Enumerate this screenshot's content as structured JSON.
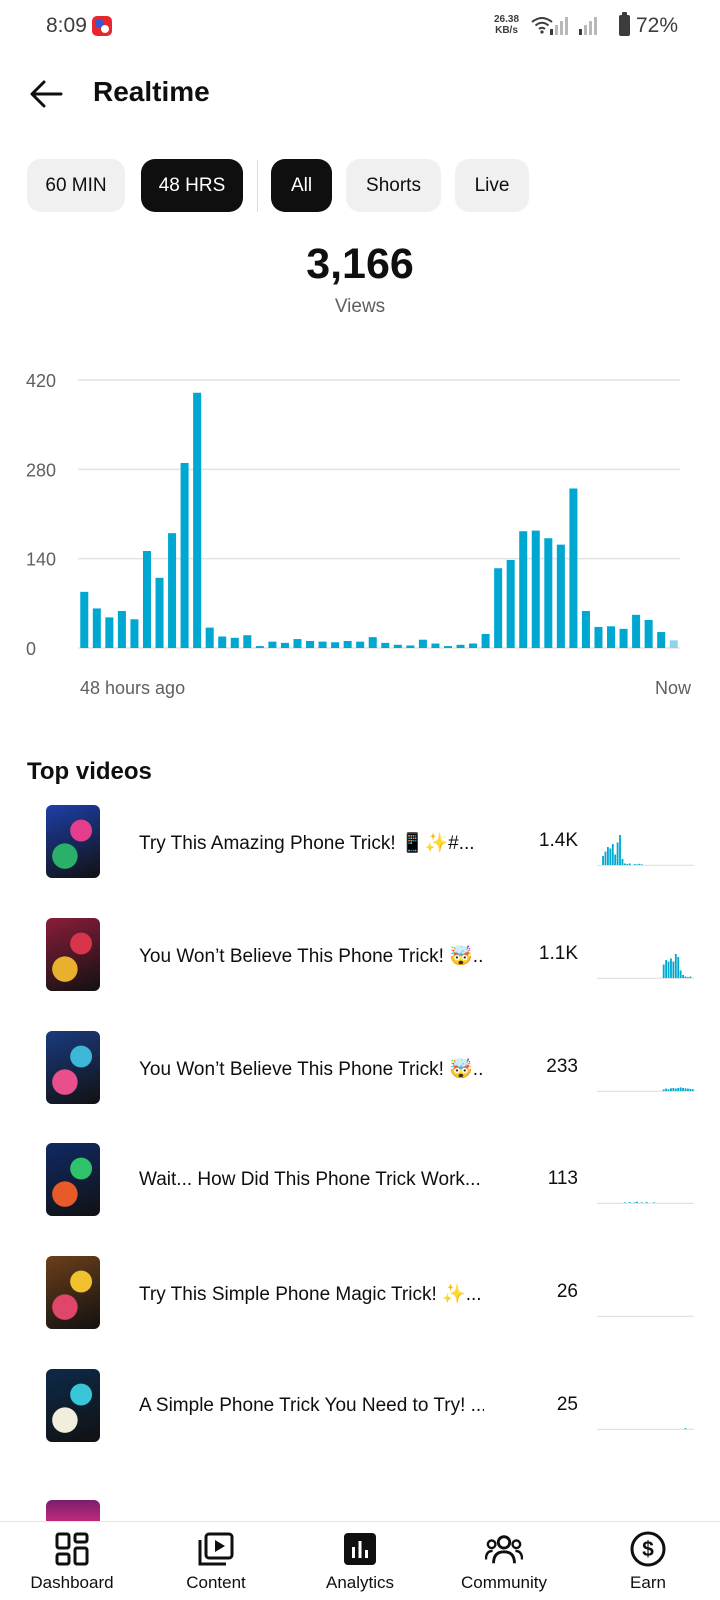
{
  "status_bar": {
    "time": "8:09",
    "net_speed_value": "26.38",
    "net_speed_unit": "KB/s",
    "battery": "72%"
  },
  "header": {
    "title": "Realtime"
  },
  "filters": {
    "time_ranges": [
      {
        "label": "60 MIN",
        "selected": false
      },
      {
        "label": "48 HRS",
        "selected": true
      }
    ],
    "content_types": [
      {
        "label": "All",
        "selected": true
      },
      {
        "label": "Shorts",
        "selected": false
      },
      {
        "label": "Live",
        "selected": false
      }
    ]
  },
  "metric": {
    "value": "3,166",
    "label": "Views"
  },
  "chart_data": {
    "type": "bar",
    "ylim": [
      0,
      420
    ],
    "yticks": [
      "420",
      "280",
      "140",
      "0"
    ],
    "x_start_label": "48 hours ago",
    "x_end_label": "Now",
    "grid": true,
    "bar_color": "#00a8d1",
    "last_bar_color": "#8fd3ea",
    "values": [
      88,
      62,
      48,
      58,
      45,
      152,
      110,
      180,
      290,
      400,
      32,
      18,
      16,
      20,
      3,
      10,
      8,
      14,
      11,
      10,
      9,
      11,
      10,
      17,
      8,
      5,
      4,
      13,
      7,
      3,
      5,
      7,
      22,
      125,
      138,
      183,
      184,
      172,
      162,
      250,
      58,
      33,
      34,
      30,
      52,
      44,
      25,
      12
    ]
  },
  "top_videos": {
    "title": "Top videos",
    "items": [
      {
        "title": "Try This Amazing Phone Trick! 📱✨#...",
        "views": "1.4K",
        "thumb_colors": [
          "#1d3fa8",
          "#e33d8c",
          "#2bb06a"
        ],
        "spark": [
          0,
          0,
          0.3,
          0.45,
          0.6,
          0.55,
          0.7,
          0.35,
          0.75,
          1.0,
          0.2,
          0.05,
          0.03,
          0.05,
          0,
          0.03,
          0.02,
          0.04,
          0.02,
          0,
          0,
          0,
          0,
          0,
          0,
          0,
          0,
          0,
          0,
          0,
          0,
          0,
          0,
          0,
          0,
          0,
          0,
          0,
          0,
          0
        ]
      },
      {
        "title": "You Won’t Believe This Phone Trick! 🤯...",
        "views": "1.1K",
        "thumb_colors": [
          "#8a1d3a",
          "#d8344c",
          "#e8b02c"
        ],
        "spark": [
          0,
          0,
          0,
          0,
          0,
          0,
          0,
          0,
          0,
          0,
          0,
          0,
          0,
          0,
          0,
          0,
          0,
          0,
          0,
          0,
          0,
          0,
          0,
          0,
          0,
          0,
          0,
          0.45,
          0.6,
          0.55,
          0.65,
          0.55,
          0.8,
          0.7,
          0.25,
          0.1,
          0.05,
          0.03,
          0.05,
          0
        ]
      },
      {
        "title": "You Won’t Believe This Phone Trick! 🤯...",
        "views": "233",
        "thumb_colors": [
          "#1a3b80",
          "#3db7d8",
          "#e84f8c"
        ],
        "spark": [
          0,
          0,
          0,
          0,
          0,
          0,
          0,
          0,
          0,
          0,
          0,
          0,
          0,
          0,
          0,
          0,
          0,
          0,
          0,
          0,
          0,
          0,
          0,
          0,
          0,
          0,
          0,
          0.05,
          0.08,
          0.06,
          0.09,
          0.1,
          0.08,
          0.1,
          0.12,
          0.1,
          0.09,
          0.08,
          0.07,
          0.06
        ]
      },
      {
        "title": "Wait... How Did This Phone Trick Work...",
        "views": "113",
        "thumb_colors": [
          "#102a66",
          "#30c26a",
          "#e95a2a"
        ],
        "spark": [
          0,
          0,
          0,
          0,
          0,
          0,
          0,
          0,
          0,
          0,
          0,
          0.02,
          0,
          0.03,
          0,
          0.02,
          0.04,
          0,
          0.02,
          0,
          0.03,
          0,
          0,
          0.02,
          0,
          0,
          0,
          0,
          0,
          0,
          0,
          0,
          0,
          0,
          0,
          0,
          0,
          0,
          0,
          0
        ]
      },
      {
        "title": "Try This Simple Phone Magic Trick! ✨...",
        "views": "26",
        "thumb_colors": [
          "#6b3f1a",
          "#f2c12e",
          "#e0456a"
        ],
        "spark": [
          0,
          0,
          0,
          0,
          0,
          0,
          0,
          0,
          0,
          0,
          0,
          0,
          0,
          0,
          0,
          0,
          0,
          0,
          0,
          0,
          0,
          0,
          0,
          0,
          0,
          0,
          0,
          0,
          0,
          0,
          0,
          0,
          0,
          0,
          0,
          0,
          0,
          0,
          0,
          0
        ]
      },
      {
        "title": "A Simple Phone Trick You Need to Try! ...",
        "views": "25",
        "thumb_colors": [
          "#0d2a4a",
          "#39c6d9",
          "#f2eedd"
        ],
        "spark": [
          0,
          0,
          0,
          0,
          0,
          0,
          0,
          0,
          0,
          0,
          0,
          0,
          0,
          0,
          0,
          0,
          0,
          0,
          0,
          0,
          0,
          0,
          0,
          0,
          0,
          0,
          0,
          0,
          0,
          0,
          0,
          0,
          0,
          0,
          0,
          0,
          0.03,
          0,
          0,
          0
        ]
      }
    ]
  },
  "bottom_nav": [
    {
      "label": "Dashboard",
      "icon": "dashboard-icon",
      "selected": false
    },
    {
      "label": "Content",
      "icon": "content-icon",
      "selected": false
    },
    {
      "label": "Analytics",
      "icon": "analytics-icon",
      "selected": true
    },
    {
      "label": "Community",
      "icon": "community-icon",
      "selected": false
    },
    {
      "label": "Earn",
      "icon": "earn-icon",
      "selected": false
    }
  ]
}
